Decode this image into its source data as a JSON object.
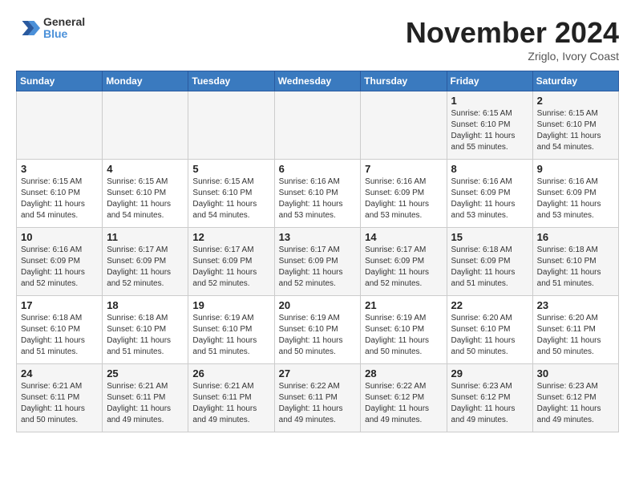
{
  "header": {
    "logo_general": "General",
    "logo_blue": "Blue",
    "month_title": "November 2024",
    "subtitle": "Zriglo, Ivory Coast"
  },
  "days_of_week": [
    "Sunday",
    "Monday",
    "Tuesday",
    "Wednesday",
    "Thursday",
    "Friday",
    "Saturday"
  ],
  "weeks": [
    [
      {
        "day": "",
        "info": ""
      },
      {
        "day": "",
        "info": ""
      },
      {
        "day": "",
        "info": ""
      },
      {
        "day": "",
        "info": ""
      },
      {
        "day": "",
        "info": ""
      },
      {
        "day": "1",
        "info": "Sunrise: 6:15 AM\nSunset: 6:10 PM\nDaylight: 11 hours\nand 55 minutes."
      },
      {
        "day": "2",
        "info": "Sunrise: 6:15 AM\nSunset: 6:10 PM\nDaylight: 11 hours\nand 54 minutes."
      }
    ],
    [
      {
        "day": "3",
        "info": "Sunrise: 6:15 AM\nSunset: 6:10 PM\nDaylight: 11 hours\nand 54 minutes."
      },
      {
        "day": "4",
        "info": "Sunrise: 6:15 AM\nSunset: 6:10 PM\nDaylight: 11 hours\nand 54 minutes."
      },
      {
        "day": "5",
        "info": "Sunrise: 6:15 AM\nSunset: 6:10 PM\nDaylight: 11 hours\nand 54 minutes."
      },
      {
        "day": "6",
        "info": "Sunrise: 6:16 AM\nSunset: 6:10 PM\nDaylight: 11 hours\nand 53 minutes."
      },
      {
        "day": "7",
        "info": "Sunrise: 6:16 AM\nSunset: 6:09 PM\nDaylight: 11 hours\nand 53 minutes."
      },
      {
        "day": "8",
        "info": "Sunrise: 6:16 AM\nSunset: 6:09 PM\nDaylight: 11 hours\nand 53 minutes."
      },
      {
        "day": "9",
        "info": "Sunrise: 6:16 AM\nSunset: 6:09 PM\nDaylight: 11 hours\nand 53 minutes."
      }
    ],
    [
      {
        "day": "10",
        "info": "Sunrise: 6:16 AM\nSunset: 6:09 PM\nDaylight: 11 hours\nand 52 minutes."
      },
      {
        "day": "11",
        "info": "Sunrise: 6:17 AM\nSunset: 6:09 PM\nDaylight: 11 hours\nand 52 minutes."
      },
      {
        "day": "12",
        "info": "Sunrise: 6:17 AM\nSunset: 6:09 PM\nDaylight: 11 hours\nand 52 minutes."
      },
      {
        "day": "13",
        "info": "Sunrise: 6:17 AM\nSunset: 6:09 PM\nDaylight: 11 hours\nand 52 minutes."
      },
      {
        "day": "14",
        "info": "Sunrise: 6:17 AM\nSunset: 6:09 PM\nDaylight: 11 hours\nand 52 minutes."
      },
      {
        "day": "15",
        "info": "Sunrise: 6:18 AM\nSunset: 6:09 PM\nDaylight: 11 hours\nand 51 minutes."
      },
      {
        "day": "16",
        "info": "Sunrise: 6:18 AM\nSunset: 6:10 PM\nDaylight: 11 hours\nand 51 minutes."
      }
    ],
    [
      {
        "day": "17",
        "info": "Sunrise: 6:18 AM\nSunset: 6:10 PM\nDaylight: 11 hours\nand 51 minutes."
      },
      {
        "day": "18",
        "info": "Sunrise: 6:18 AM\nSunset: 6:10 PM\nDaylight: 11 hours\nand 51 minutes."
      },
      {
        "day": "19",
        "info": "Sunrise: 6:19 AM\nSunset: 6:10 PM\nDaylight: 11 hours\nand 51 minutes."
      },
      {
        "day": "20",
        "info": "Sunrise: 6:19 AM\nSunset: 6:10 PM\nDaylight: 11 hours\nand 50 minutes."
      },
      {
        "day": "21",
        "info": "Sunrise: 6:19 AM\nSunset: 6:10 PM\nDaylight: 11 hours\nand 50 minutes."
      },
      {
        "day": "22",
        "info": "Sunrise: 6:20 AM\nSunset: 6:10 PM\nDaylight: 11 hours\nand 50 minutes."
      },
      {
        "day": "23",
        "info": "Sunrise: 6:20 AM\nSunset: 6:11 PM\nDaylight: 11 hours\nand 50 minutes."
      }
    ],
    [
      {
        "day": "24",
        "info": "Sunrise: 6:21 AM\nSunset: 6:11 PM\nDaylight: 11 hours\nand 50 minutes."
      },
      {
        "day": "25",
        "info": "Sunrise: 6:21 AM\nSunset: 6:11 PM\nDaylight: 11 hours\nand 49 minutes."
      },
      {
        "day": "26",
        "info": "Sunrise: 6:21 AM\nSunset: 6:11 PM\nDaylight: 11 hours\nand 49 minutes."
      },
      {
        "day": "27",
        "info": "Sunrise: 6:22 AM\nSunset: 6:11 PM\nDaylight: 11 hours\nand 49 minutes."
      },
      {
        "day": "28",
        "info": "Sunrise: 6:22 AM\nSunset: 6:12 PM\nDaylight: 11 hours\nand 49 minutes."
      },
      {
        "day": "29",
        "info": "Sunrise: 6:23 AM\nSunset: 6:12 PM\nDaylight: 11 hours\nand 49 minutes."
      },
      {
        "day": "30",
        "info": "Sunrise: 6:23 AM\nSunset: 6:12 PM\nDaylight: 11 hours\nand 49 minutes."
      }
    ]
  ]
}
